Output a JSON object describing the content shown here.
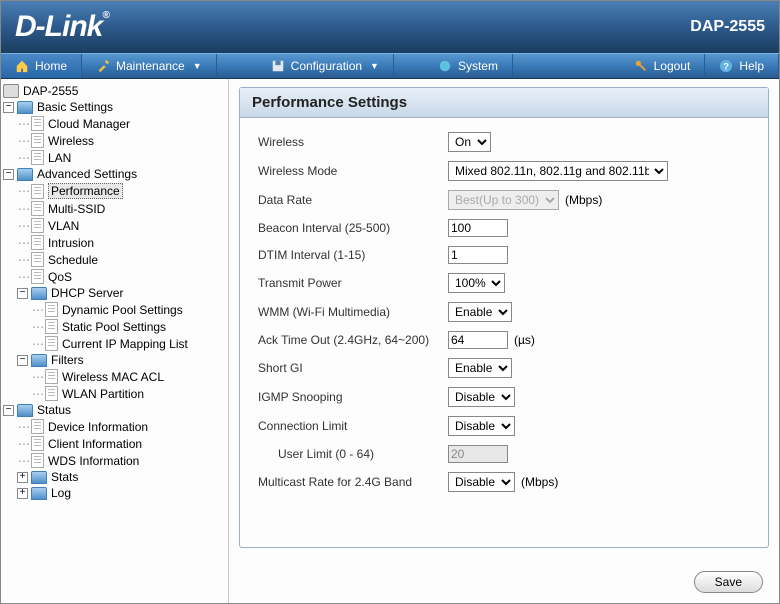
{
  "header": {
    "logo": "D-Link",
    "model": "DAP-2555"
  },
  "nav": {
    "home": "Home",
    "maintenance": "Maintenance",
    "configuration": "Configuration",
    "system": "System",
    "logout": "Logout",
    "help": "Help"
  },
  "sidebar": {
    "device": "DAP-2555",
    "basic": {
      "label": "Basic Settings",
      "items": [
        "Cloud Manager",
        "Wireless",
        "LAN"
      ]
    },
    "advanced": {
      "label": "Advanced Settings",
      "performance": "Performance",
      "multi_ssid": "Multi-SSID",
      "vlan": "VLAN",
      "intrusion": "Intrusion",
      "schedule": "Schedule",
      "qos": "QoS",
      "dhcp": {
        "label": "DHCP Server",
        "items": [
          "Dynamic Pool Settings",
          "Static Pool Settings",
          "Current IP Mapping List"
        ]
      },
      "filters": {
        "label": "Filters",
        "items": [
          "Wireless MAC ACL",
          "WLAN Partition"
        ]
      }
    },
    "status": {
      "label": "Status",
      "device_info": "Device Information",
      "client_info": "Client Information",
      "wds_info": "WDS Information",
      "stats": "Stats",
      "log": "Log"
    }
  },
  "panel": {
    "title": "Performance Settings",
    "fields": {
      "wireless": {
        "label": "Wireless",
        "value": "On"
      },
      "wireless_mode": {
        "label": "Wireless Mode",
        "value": "Mixed 802.11n, 802.11g and 802.11b"
      },
      "data_rate": {
        "label": "Data Rate",
        "value": "Best(Up to 300)",
        "unit": "(Mbps)"
      },
      "beacon": {
        "label": "Beacon Interval (25-500)",
        "value": "100"
      },
      "dtim": {
        "label": "DTIM Interval (1-15)",
        "value": "1"
      },
      "tx_power": {
        "label": "Transmit Power",
        "value": "100%"
      },
      "wmm": {
        "label": "WMM (Wi-Fi Multimedia)",
        "value": "Enable"
      },
      "ack": {
        "label": "Ack Time Out  (2.4GHz, 64~200)",
        "value": "64",
        "unit": "(µs)"
      },
      "short_gi": {
        "label": "Short GI",
        "value": "Enable"
      },
      "igmp": {
        "label": "IGMP Snooping",
        "value": "Disable"
      },
      "conn_limit": {
        "label": "Connection Limit",
        "value": "Disable"
      },
      "user_limit": {
        "label": "User Limit (0 - 64)",
        "value": "20"
      },
      "mcast_rate": {
        "label": "Multicast Rate for 2.4G Band",
        "value": "Disable",
        "unit": "(Mbps)"
      }
    },
    "save": "Save"
  }
}
